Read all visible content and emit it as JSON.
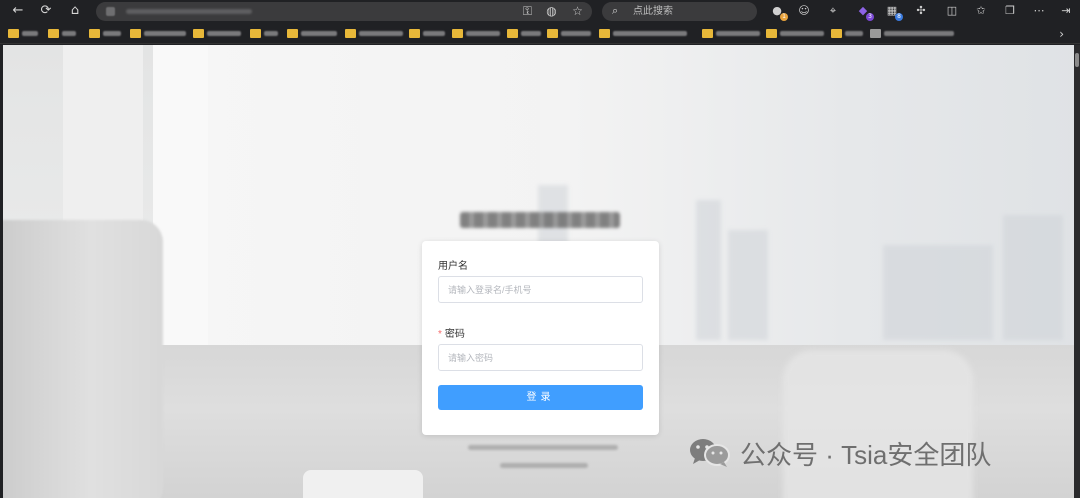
{
  "browser": {
    "search_placeholder": "点此搜索",
    "extensions": [
      {
        "icon": "copilot-extension-icon",
        "badge": "1",
        "badge_color": "#e8a33d"
      },
      {
        "icon": "ghost-extension-icon",
        "badge": "",
        "badge_color": ""
      },
      {
        "icon": "pin-extension-icon",
        "badge": "",
        "badge_color": ""
      },
      {
        "icon": "purple-extension-icon",
        "badge": "3",
        "badge_color": "#7b49d6"
      },
      {
        "icon": "grid-extension-icon",
        "badge": "8",
        "badge_color": "#3a7be0"
      }
    ]
  },
  "login": {
    "username_label": "用户名",
    "username_placeholder": "请输入登录名/手机号",
    "username_value": "",
    "password_required_mark": "*",
    "password_label": "密码",
    "password_placeholder": "请输入密码",
    "password_value": "",
    "submit_label": "登录"
  },
  "watermark": {
    "text": "公众号 · Tsia安全团队"
  },
  "colors": {
    "primary": "#409eff",
    "required": "#f56c6c",
    "bookmark_folder": "#e8b839"
  }
}
